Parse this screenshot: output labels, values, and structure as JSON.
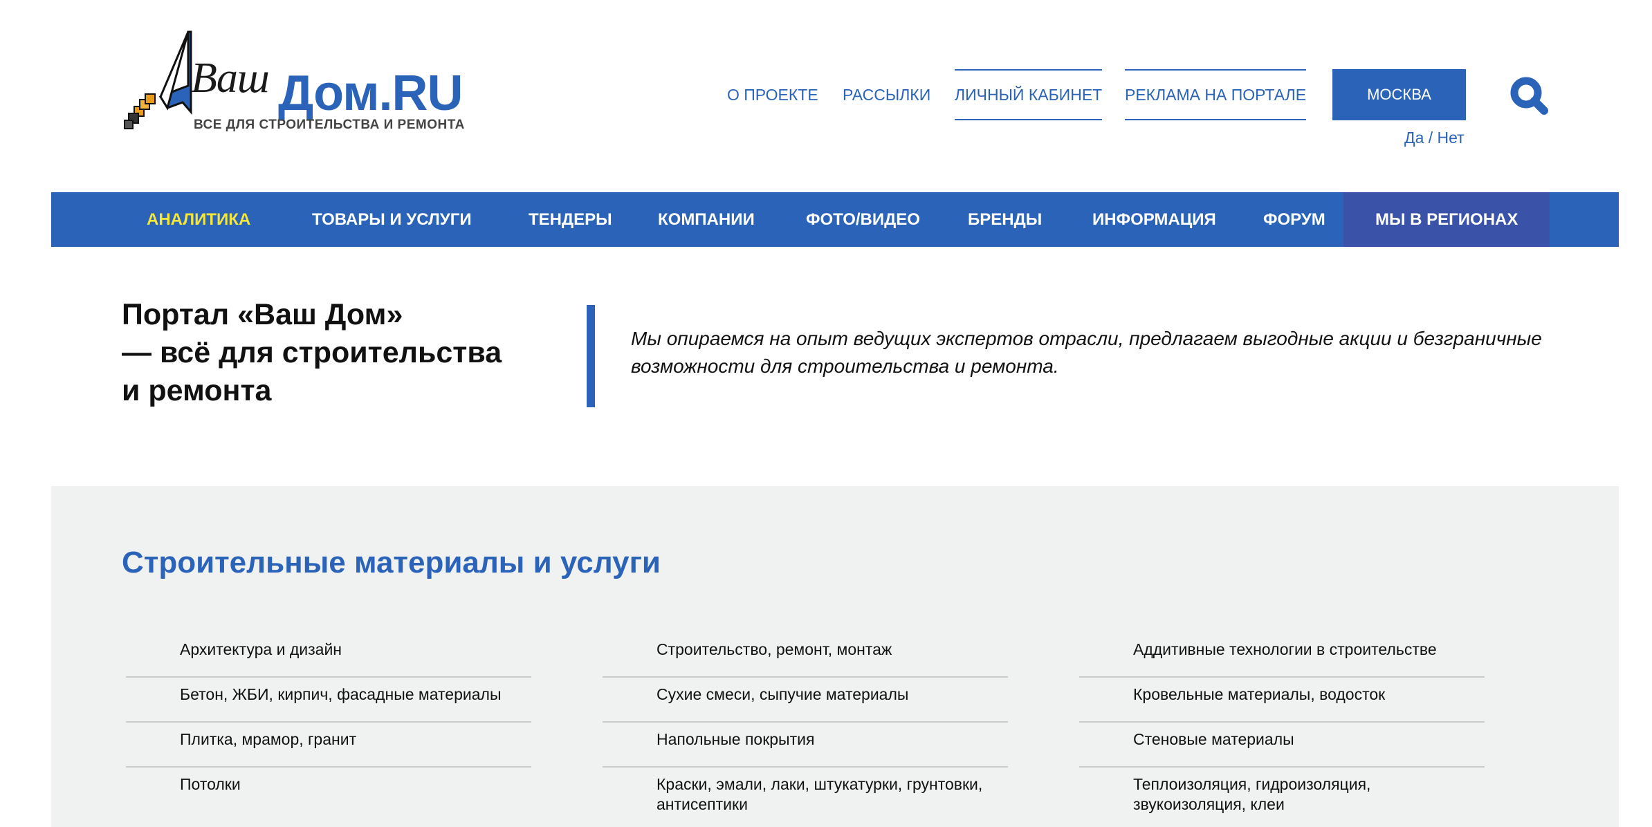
{
  "logo": {
    "vash": "Ваш",
    "dom": "Дом.RU",
    "tagline": "ВСЕ ДЛЯ СТРОИТЕЛЬСТВА И РЕМОНТА"
  },
  "header": {
    "links": [
      "О ПРОЕКТЕ",
      "РАССЫЛКИ",
      "ЛИЧНЫЙ КАБИНЕТ",
      "РЕКЛАМА НА ПОРТАЛЕ"
    ],
    "city": "МОСКВА",
    "city_confirm_yes": "Да",
    "city_confirm_sep": " / ",
    "city_confirm_no": "Нет",
    "search_icon": "search-icon"
  },
  "nav": {
    "items": [
      "АНАЛИТИКА",
      "ТОВАРЫ И УСЛУГИ",
      "ТЕНДЕРЫ",
      "КОМПАНИИ",
      "ФОТО/ВИДЕО",
      "БРЕНДЫ",
      "ИНФОРМАЦИЯ",
      "ФОРУМ",
      "МЫ В РЕГИОНАХ"
    ],
    "active_index": 0
  },
  "intro": {
    "title_lines": [
      "Портал «Ваш Дом»",
      "— всё для строительства",
      "и ремонта"
    ],
    "text": "Мы опираемся на опыт ведущих экспертов отрасли, предлагаем выгодные акции и безграничные возможности для строительства и ремонта."
  },
  "materials": {
    "heading": "Строительные материалы и услуги",
    "columns": [
      [
        "Архитектура и дизайн",
        "Бетон, ЖБИ, кирпич, фасадные материалы",
        "Плитка, мрамор, гранит",
        "Потолки"
      ],
      [
        "Строительство, ремонт, монтаж",
        "Сухие смеси, сыпучие материалы",
        "Напольные покрытия",
        "Краски, эмали, лаки, штукатурки, грунтовки, антисептики"
      ],
      [
        "Аддитивные технологии в строительстве",
        "Кровельные материалы, водосток",
        "Стеновые материалы",
        "Теплоизоляция, гидроизоляция, звукоизоляция, клеи"
      ]
    ]
  },
  "colors": {
    "brand_blue": "#2a63b8",
    "nav_active": "#f5e63a",
    "regions_bg": "#3a52a8",
    "section_bg": "#f0f1f1"
  }
}
